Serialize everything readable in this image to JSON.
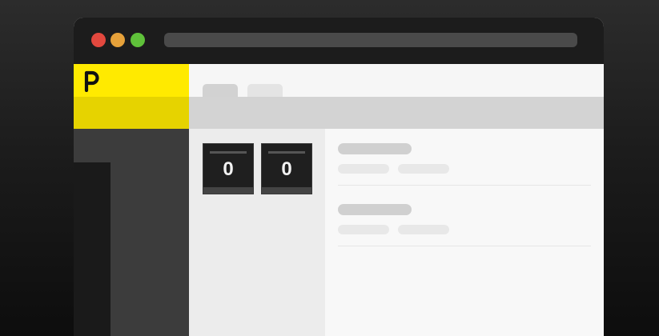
{
  "window": {
    "controls": [
      {
        "name": "close",
        "color": "#e2483e"
      },
      {
        "name": "minimize",
        "color": "#e6a13a"
      },
      {
        "name": "maximize",
        "color": "#5fc13a"
      }
    ],
    "address_bar": {
      "value": ""
    }
  },
  "brand": {
    "logo_icon": "p-logo-icon",
    "accent_color": "#ffea00"
  },
  "tabs": [
    {
      "label": ""
    },
    {
      "label": ""
    }
  ],
  "counters": [
    {
      "value": "0"
    },
    {
      "value": "0"
    }
  ],
  "list_items": [
    {
      "title": "",
      "chips": [
        "",
        ""
      ]
    },
    {
      "title": "",
      "chips": [
        "",
        ""
      ]
    }
  ]
}
